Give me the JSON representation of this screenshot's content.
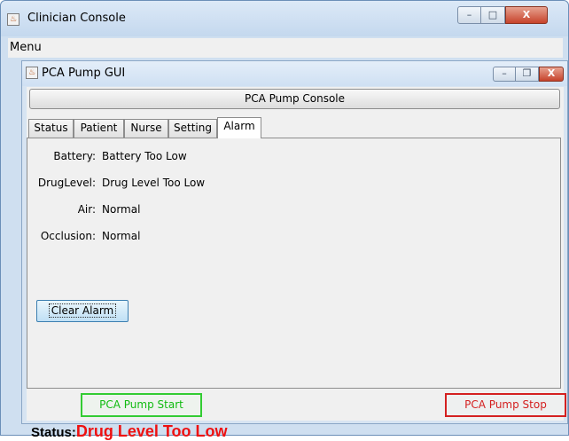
{
  "outer_window": {
    "title": "Clinician Console",
    "controls": {
      "minimize": "–",
      "maximize": "□",
      "close": "X"
    }
  },
  "menubar": {
    "menu_label": "Menu"
  },
  "inner_window": {
    "title": "PCA Pump GUI",
    "controls": {
      "minimize": "–",
      "restore": "❐",
      "close": "X"
    }
  },
  "console_button_label": "PCA Pump Console",
  "tabs": [
    {
      "label": "Status",
      "active": false
    },
    {
      "label": "Patient",
      "active": false
    },
    {
      "label": "Nurse",
      "active": false
    },
    {
      "label": "Setting",
      "active": false
    },
    {
      "label": "Alarm",
      "active": true
    }
  ],
  "alarm_panel": {
    "fields": [
      {
        "label": "Battery:",
        "value": "Battery Too Low"
      },
      {
        "label": "DrugLevel:",
        "value": "Drug Level Too Low"
      },
      {
        "label": "Air:",
        "value": "Normal"
      },
      {
        "label": "Occlusion:",
        "value": "Normal"
      }
    ],
    "clear_button": "Clear Alarm"
  },
  "start_button": "PCA Pump Start",
  "stop_button": "PCA Pump Stop",
  "status": {
    "label": "Status:",
    "value": "Drug Level Too Low"
  },
  "colors": {
    "start": "#33cc33",
    "stop": "#d42020",
    "status_value": "#ee1111"
  }
}
